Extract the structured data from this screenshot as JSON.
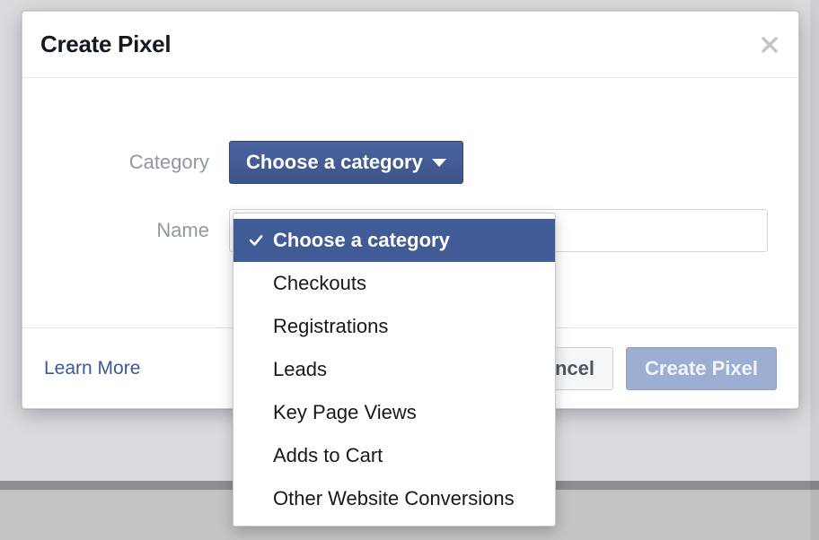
{
  "dialog": {
    "title": "Create Pixel",
    "close_label": "Close"
  },
  "form": {
    "category_label": "Category",
    "category_button": "Choose a category",
    "name_label": "Name",
    "name_value": ""
  },
  "dropdown": {
    "items": [
      {
        "label": "Choose a category",
        "selected": true
      },
      {
        "label": "Checkouts",
        "selected": false
      },
      {
        "label": "Registrations",
        "selected": false
      },
      {
        "label": "Leads",
        "selected": false
      },
      {
        "label": "Key Page Views",
        "selected": false
      },
      {
        "label": "Adds to Cart",
        "selected": false
      },
      {
        "label": "Other Website Conversions",
        "selected": false
      }
    ]
  },
  "footer": {
    "learn_more": "Learn More",
    "cancel": "Cancel",
    "primary": "Create Pixel"
  }
}
